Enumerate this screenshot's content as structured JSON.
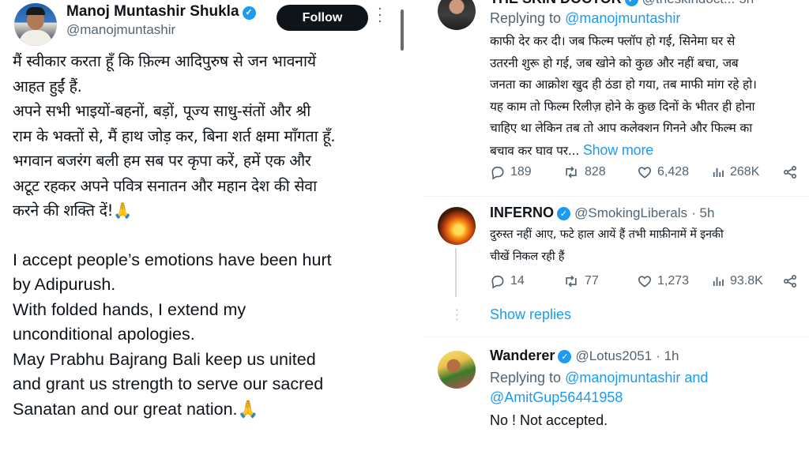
{
  "original_post": {
    "author_name": "Manoj Muntashir Shukla",
    "author_handle": "@manojmuntashir",
    "follow_label": "Follow",
    "text_hindi": [
      "मैं स्वीकार करता हूँ कि फ़िल्म आदिपुरुष से जन भावनायें",
      "आहत हुईं हैं.",
      "अपने सभी भाइयों-बहनों, बड़ों, पूज्य साधु-संतों और श्री",
      "राम के भक्तों से, मैं हाथ जोड़ कर, बिना शर्त क्षमा माँगता हूँ.",
      "भगवान बजरंग बली हम सब पर कृपा करें, हमें एक और",
      "अटूट रहकर अपने पवित्र सनातन और महान देश की सेवा",
      "करने की शक्ति दें!🙏"
    ],
    "text_english": [
      "I accept people’s emotions have been hurt",
      "by Adipurush.",
      "With folded hands, I extend my",
      "unconditional apologies.",
      "May Prabhu Bajrang Bali keep us united",
      "and grant us strength to serve our sacred",
      "Sanatan and our great nation.🙏"
    ]
  },
  "replies": [
    {
      "author_name": "THE SKIN DOCTOR",
      "author_handle_partial": "@theskindoct...",
      "time": "5h",
      "replying_label": "Replying to",
      "replying_to": "@manojmuntashir",
      "text_lines": [
        "काफी देर कर दी। जब फिल्म फ्लॉप हो गई, सिनेमा घर से",
        "उतरनी शुरू हो गई, जब खोने को कुछ और नहीं बचा, जब",
        "जनता का आक्रोश खुद ही ठंडा हो गया, तब माफी मांग रहे हो।",
        "यह काम तो फिल्म रिलीज़ होने के कुछ दिनों के भीतर ही होना",
        "चाहिए था लेकिन तब तो आप कलेक्शन गिनने और फिल्म का",
        "बचाव कर घाव पर..."
      ],
      "show_more": "Show more",
      "stats": {
        "replies": "189",
        "reposts": "828",
        "likes": "6,428",
        "views": "268K"
      }
    },
    {
      "author_name": "INFERNO",
      "author_handle": "@SmokingLiberals",
      "time": "· 5h",
      "text_lines": [
        "दुरुस्त नहीं आए, फटे हाल आयें हैं तभी माफ़ीनामें में इनकी",
        "चीखें निकल रही हैं"
      ],
      "stats": {
        "replies": "14",
        "reposts": "77",
        "likes": "1,273",
        "views": "93.8K"
      },
      "show_replies": "Show replies"
    },
    {
      "author_name": "Wanderer",
      "author_handle": "@Lotus2051",
      "time": "· 1h",
      "replying_label": "Replying to",
      "replying_to": "@manojmuntashir and",
      "replying_to_2": "@AmitGup56441958",
      "text": "No ! Not accepted."
    }
  ],
  "colors": {
    "verified_blue": "#1d9bf0",
    "link_blue": "#1d9bf0",
    "muted_gray": "#536471",
    "text_black": "#0f1419",
    "follow_button_bg": "#0f1419"
  },
  "icons": [
    "verified-badge-icon",
    "more-options-icon",
    "reply-icon",
    "repost-icon",
    "like-icon",
    "views-icon",
    "share-icon",
    "folded-hands-emoji"
  ]
}
